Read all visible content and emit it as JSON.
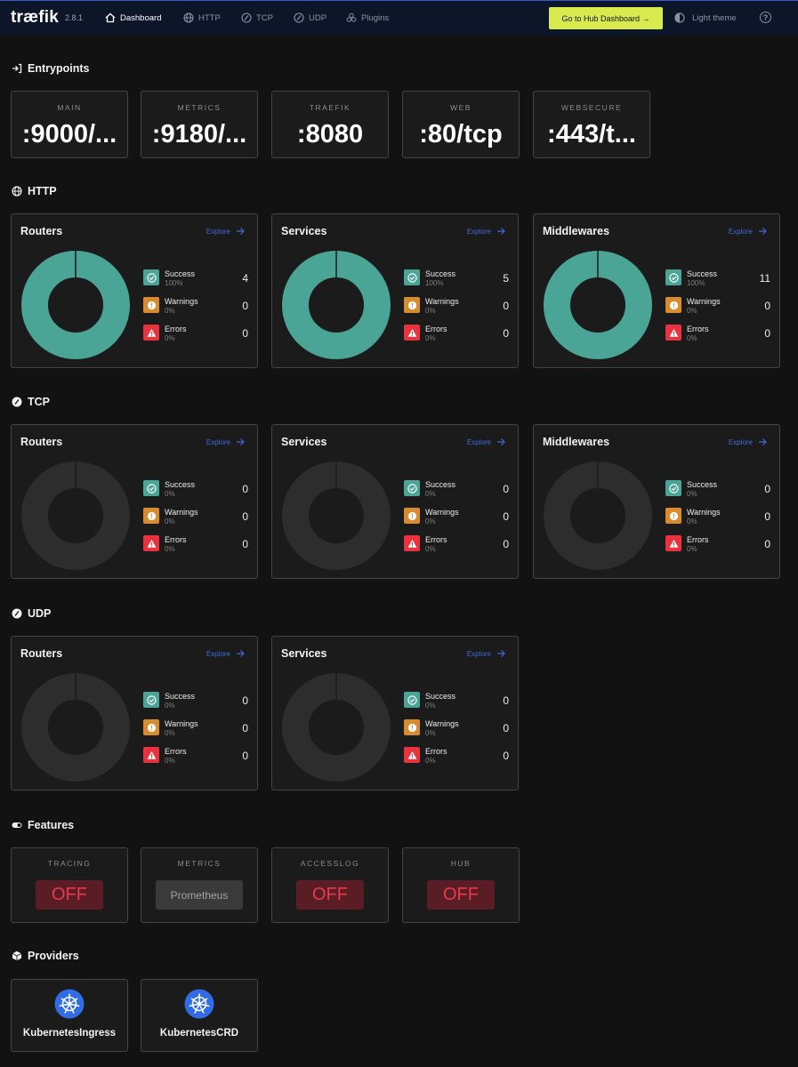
{
  "header": {
    "logo": "træfik",
    "version": "2.8.1",
    "nav": [
      {
        "label": "Dashboard",
        "icon": "home-icon",
        "active": true
      },
      {
        "label": "HTTP",
        "icon": "globe-icon",
        "active": false
      },
      {
        "label": "TCP",
        "icon": "tcp-icon",
        "active": false
      },
      {
        "label": "UDP",
        "icon": "udp-icon",
        "active": false
      },
      {
        "label": "Plugins",
        "icon": "plugins-icon",
        "active": false
      }
    ],
    "hub_button": "Go to Hub Dashboard →",
    "theme_button": "Light theme",
    "help": "?"
  },
  "entrypoints": {
    "title": "Entrypoints",
    "items": [
      {
        "name": "MAIN",
        "value": ":9000/..."
      },
      {
        "name": "METRICS",
        "value": ":9180/..."
      },
      {
        "name": "TRAEFIK",
        "value": ":8080"
      },
      {
        "name": "WEB",
        "value": ":80/tcp"
      },
      {
        "name": "WEBSECURE",
        "value": ":443/t..."
      }
    ]
  },
  "explore_label": "Explore",
  "legend_labels": {
    "success": "Success",
    "warnings": "Warnings",
    "errors": "Errors"
  },
  "sections": [
    {
      "title": "HTTP",
      "cards": [
        {
          "title": "Routers",
          "success": 4,
          "success_pct": "100%",
          "warnings": 0,
          "warnings_pct": "0%",
          "errors": 0,
          "errors_pct": "0%"
        },
        {
          "title": "Services",
          "success": 5,
          "success_pct": "100%",
          "warnings": 0,
          "warnings_pct": "0%",
          "errors": 0,
          "errors_pct": "0%"
        },
        {
          "title": "Middlewares",
          "success": 11,
          "success_pct": "100%",
          "warnings": 0,
          "warnings_pct": "0%",
          "errors": 0,
          "errors_pct": "0%"
        }
      ]
    },
    {
      "title": "TCP",
      "cards": [
        {
          "title": "Routers",
          "success": 0,
          "success_pct": "0%",
          "warnings": 0,
          "warnings_pct": "0%",
          "errors": 0,
          "errors_pct": "0%"
        },
        {
          "title": "Services",
          "success": 0,
          "success_pct": "0%",
          "warnings": 0,
          "warnings_pct": "0%",
          "errors": 0,
          "errors_pct": "0%"
        },
        {
          "title": "Middlewares",
          "success": 0,
          "success_pct": "0%",
          "warnings": 0,
          "warnings_pct": "0%",
          "errors": 0,
          "errors_pct": "0%"
        }
      ]
    },
    {
      "title": "UDP",
      "cards": [
        {
          "title": "Routers",
          "success": 0,
          "success_pct": "0%",
          "warnings": 0,
          "warnings_pct": "0%",
          "errors": 0,
          "errors_pct": "0%"
        },
        {
          "title": "Services",
          "success": 0,
          "success_pct": "0%",
          "warnings": 0,
          "warnings_pct": "0%",
          "errors": 0,
          "errors_pct": "0%"
        }
      ]
    }
  ],
  "features": {
    "title": "Features",
    "items": [
      {
        "name": "TRACING",
        "value": "OFF",
        "state": "off"
      },
      {
        "name": "METRICS",
        "value": "Prometheus",
        "state": "on"
      },
      {
        "name": "ACCESSLOG",
        "value": "OFF",
        "state": "off"
      },
      {
        "name": "HUB",
        "value": "OFF",
        "state": "off"
      }
    ]
  },
  "providers": {
    "title": "Providers",
    "items": [
      {
        "name": "KubernetesIngress",
        "icon": "kubernetes-icon"
      },
      {
        "name": "KubernetesCRD",
        "icon": "kubernetes-icon"
      }
    ]
  },
  "colors": {
    "success": "#4aa596",
    "warning": "#d88c2e",
    "error": "#e8333f",
    "donut_empty": "#2d2d2d",
    "accent": "#d9ea4f",
    "link": "#3f6ad8"
  }
}
